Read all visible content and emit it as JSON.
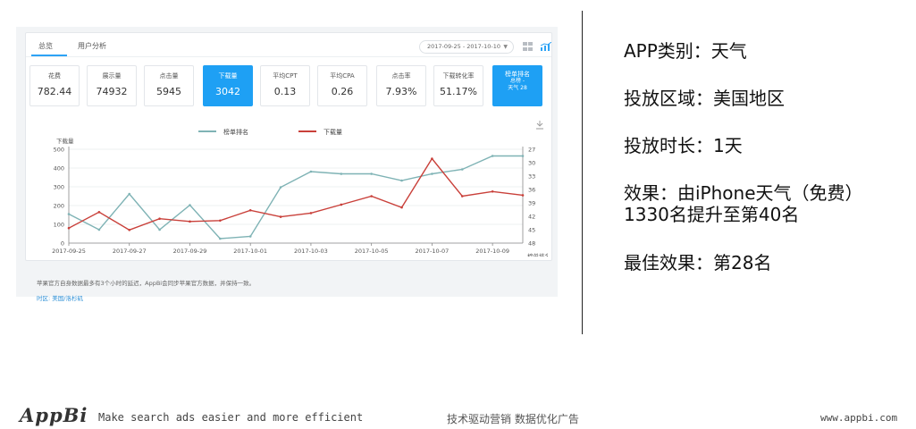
{
  "dashboard": {
    "tabs": [
      {
        "label": "总览"
      },
      {
        "label": "用户分析"
      }
    ],
    "date_range": "2017-09-25 - 2017-10-10",
    "metrics": [
      {
        "label": "花费",
        "value": "782.44"
      },
      {
        "label": "展示量",
        "value": "74932"
      },
      {
        "label": "点击量",
        "value": "5945"
      },
      {
        "label": "下载量",
        "value": "3042"
      },
      {
        "label": "平均CPT",
        "value": "0.13"
      },
      {
        "label": "平均CPA",
        "value": "0.26"
      },
      {
        "label": "点击率",
        "value": "7.93%"
      },
      {
        "label": "下载转化率",
        "value": "51.17%"
      }
    ],
    "rank_card": {
      "label": "榜单排名",
      "sub1": "总榜 -",
      "sub2": "天气 28"
    },
    "footnote": "苹果官方自身数据最多有3个小时的延迟，AppBi会同步苹果官方数据，并保持一致。",
    "timezone": "时区: 美国/洛杉矶",
    "colors": {
      "accent": "#1ea0f4",
      "rank_series": "#7fb3b5",
      "download_series": "#c9403a"
    }
  },
  "chart_data": {
    "type": "line",
    "x": [
      "2017-09-25",
      "2017-09-26",
      "2017-09-27",
      "2017-09-28",
      "2017-09-29",
      "2017-09-30",
      "2017-10-01",
      "2017-10-02",
      "2017-10-03",
      "2017-10-04",
      "2017-10-05",
      "2017-10-06",
      "2017-10-07",
      "2017-10-08",
      "2017-10-09",
      "2017-10-10"
    ],
    "x_tick_labels": [
      "2017-09-25",
      "2017-09-27",
      "2017-09-29",
      "2017-10-01",
      "2017-10-03",
      "2017-10-05",
      "2017-10-07",
      "2017-10-09"
    ],
    "series": [
      {
        "name": "榜单排名",
        "axis": "right",
        "values": [
          41.5,
          45,
          37,
          45,
          39.5,
          47,
          46.5,
          35.5,
          32,
          32.5,
          32.5,
          34,
          32.5,
          31.5,
          28.5,
          28.5
        ]
      },
      {
        "name": "下载量",
        "axis": "left",
        "values": [
          80,
          165,
          70,
          130,
          115,
          120,
          175,
          140,
          160,
          205,
          250,
          190,
          450,
          250,
          275,
          255
        ]
      }
    ],
    "ylabel_left": "下载量",
    "ylabel_right": "榜单排名",
    "ylim_left": [
      0,
      500
    ],
    "yticks_left": [
      "0",
      "100",
      "200",
      "300",
      "400",
      "500"
    ],
    "ylim_right": [
      27,
      48
    ],
    "right_axis_inverted": true,
    "yticks_right": [
      "27",
      "30",
      "33",
      "36",
      "39",
      "42",
      "45",
      "48"
    ],
    "legend_position": "top-center",
    "grid": "horizontal"
  },
  "notes": {
    "category": "APP类别：天气",
    "region": "投放区域：美国地区",
    "duration": "投放时长：1天",
    "effect_line1": "效果：由iPhone天气（免费）",
    "effect_line2": "1330名提升至第40名",
    "best": "最佳效果：第28名"
  },
  "footer": {
    "logo": "AppBi",
    "slogan": "Make search ads easier and more efficient",
    "cn_slogan": "技术驱动营销 数据优化广告",
    "website": "www.appbi.com"
  }
}
